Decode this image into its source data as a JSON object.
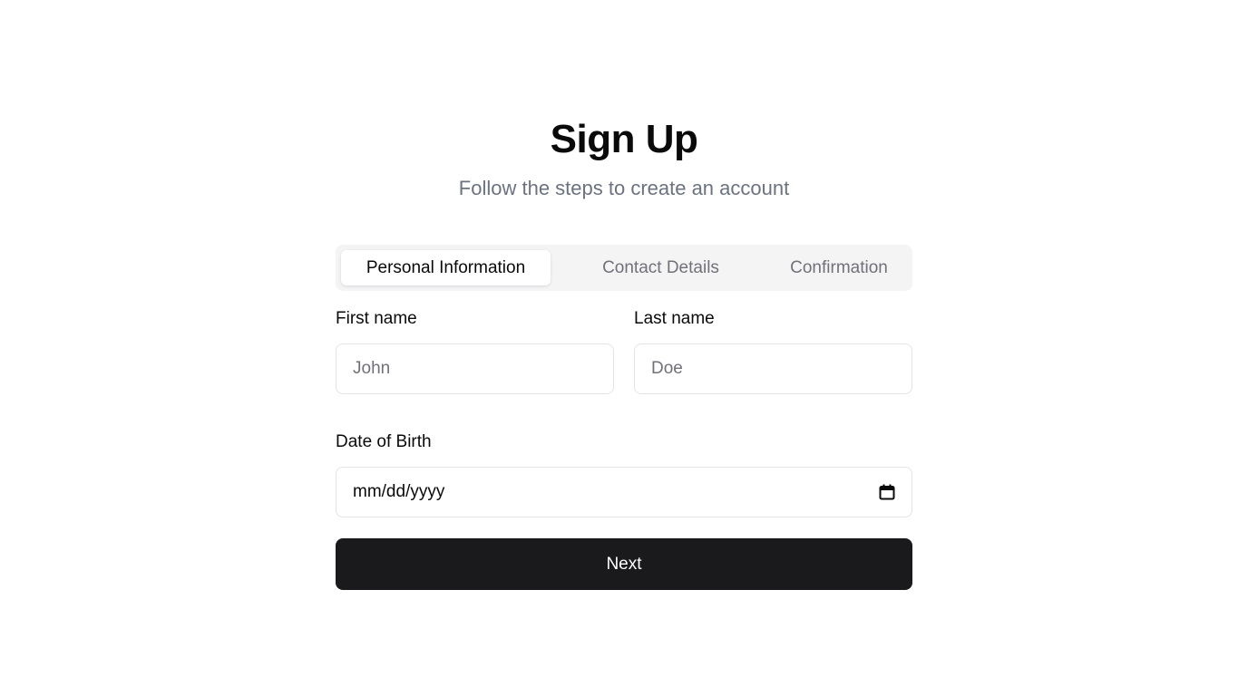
{
  "header": {
    "title": "Sign Up",
    "subtitle": "Follow the steps to create an account"
  },
  "tabs": [
    {
      "label": "Personal Information",
      "active": true
    },
    {
      "label": "Contact Details",
      "active": false
    },
    {
      "label": "Confirmation",
      "active": false
    }
  ],
  "form": {
    "first_name": {
      "label": "First name",
      "placeholder": "John",
      "value": ""
    },
    "last_name": {
      "label": "Last name",
      "placeholder": "Doe",
      "value": ""
    },
    "dob": {
      "label": "Date of Birth",
      "value": "mm/dd/yyyy",
      "icon": "calendar-icon"
    },
    "next_label": "Next"
  },
  "colors": {
    "primary_button": "#1a1a1c",
    "tab_background": "#f4f4f5",
    "muted_text": "#6b7280"
  }
}
